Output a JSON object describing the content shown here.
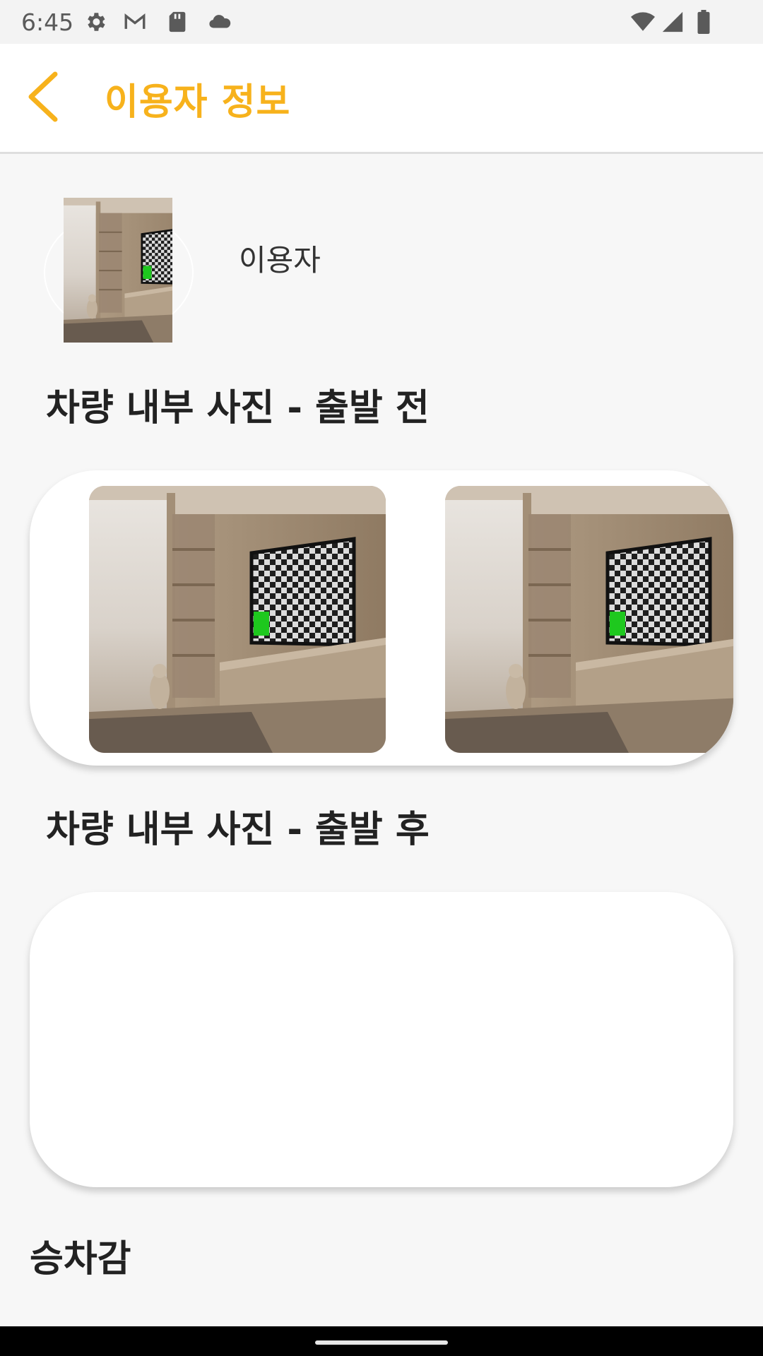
{
  "status_bar": {
    "time": "6:45",
    "icons": [
      "settings-icon",
      "gmail-icon",
      "sd-card-icon",
      "cloud-icon",
      "wifi-icon",
      "cell-signal-icon",
      "battery-icon"
    ]
  },
  "app_bar": {
    "title": "이용자 정보",
    "back_icon": "chevron-left-icon",
    "accent_color": "#f7b21c"
  },
  "user": {
    "label": "이용자"
  },
  "sections": {
    "before_title": "차량 내부 사진 - 출발 전",
    "after_title": "차량 내부 사진 - 출발 후",
    "rating_title": "승차감"
  },
  "before_photos": [
    {
      "name": "room-photo-1"
    },
    {
      "name": "room-photo-2"
    }
  ],
  "after_photos": []
}
